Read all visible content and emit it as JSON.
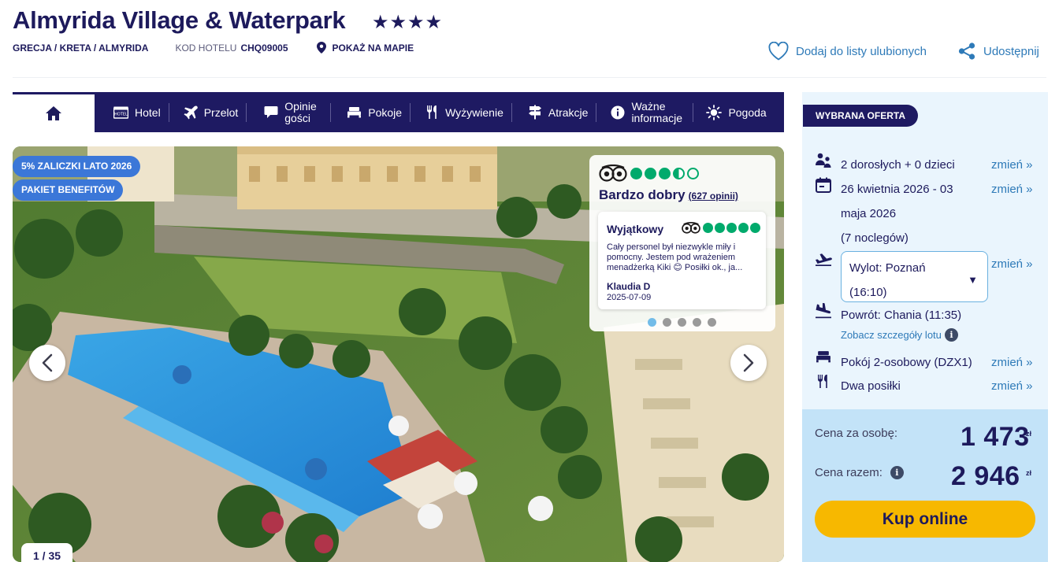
{
  "hotel": {
    "name": "Almyrida Village & Waterpark",
    "stars": "★★★★",
    "location": "GRECJA / KRETA / ALMYRIDA",
    "code_label": "KOD HOTELU",
    "code": "CHQ09005",
    "map_link": "POKAŻ NA MAPIE"
  },
  "actions": {
    "favorite": "Dodaj do listy ulubionych",
    "share": "Udostępnij"
  },
  "nav": {
    "items": [
      {
        "label": "Hotel",
        "icon": "hotel-icon"
      },
      {
        "label": "Przelot",
        "icon": "plane-icon"
      },
      {
        "label": "Opinie gości",
        "icon": "speech-bubble-icon"
      },
      {
        "label": "Pokoje",
        "icon": "bed-icon"
      },
      {
        "label": "Wyżywienie",
        "icon": "cutlery-icon"
      },
      {
        "label": "Atrakcje",
        "icon": "signpost-icon"
      },
      {
        "label": "Ważne informacje",
        "icon": "info-icon"
      },
      {
        "label": "Pogoda",
        "icon": "sun-icon"
      }
    ]
  },
  "gallery": {
    "badges": [
      "5% ZALICZKI LATO 2026",
      "PAKIET BENEFITÓW"
    ],
    "counter": "1 / 35"
  },
  "review": {
    "rating": 3.5,
    "label": "Bardzo dobry",
    "count": "(627 opinii)",
    "item": {
      "title": "Wyjątkowy",
      "rating": 5,
      "text": "Cały personel był niezwykle miły i pomocny. Jestem pod wrażeniem menadżerką Kiki 😊 Posiłki ok., ja...",
      "author": "Klaudia D",
      "date": "2025-07-09"
    },
    "pager_count": 5,
    "pager_active": 1
  },
  "offer": {
    "tag": "WYBRANA OFERTA",
    "guests": "2 dorosłych + 0 dzieci",
    "dates_line1": "26 kwietnia 2026 - 03",
    "dates_line2": "maja 2026",
    "nights": "(7 noclegów)",
    "departure_line1": "Wylot: Poznań",
    "departure_line2": "(16:10)",
    "return": "Powrót: Chania (11:35)",
    "flight_details": "Zobacz szczegóły lotu",
    "room": "Pokój 2-osobowy (DZX1)",
    "board": "Dwa posiłki",
    "change_label": "zmień »",
    "price_per_person_label": "Cena za osobę:",
    "price_per_person": "1 473",
    "price_total_label": "Cena razem:",
    "price_total": "2 946",
    "currency": "zł",
    "buy_button": "Kup online"
  },
  "colors": {
    "navy": "#1e1a62",
    "link": "#2e7ab8",
    "accent_yellow": "#f7b800",
    "badge_blue": "#3b77d8",
    "tripadvisor_green": "#00aa6c",
    "offer_bg": "#eaf5fd",
    "price_bg": "#c3e3f8"
  }
}
